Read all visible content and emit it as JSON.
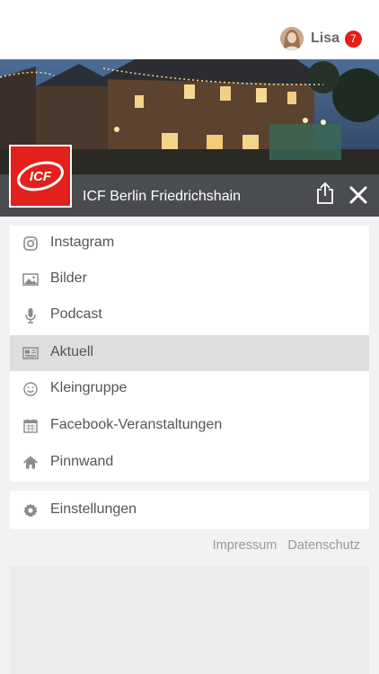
{
  "header": {
    "user_name": "Lisa",
    "notification_count": "7",
    "badge_color": "#e3201b"
  },
  "hero": {
    "church_name": "ICF Berlin Friedrichshain",
    "logo_text": "ICF",
    "share_icon": "share-icon",
    "close_icon": "close-icon"
  },
  "menu": {
    "items": [
      {
        "label": "Instagram",
        "icon": "instagram-icon",
        "active": false
      },
      {
        "label": "Bilder",
        "icon": "image-icon",
        "active": false
      },
      {
        "label": "Podcast",
        "icon": "microphone-icon",
        "active": false
      },
      {
        "label": "Aktuell",
        "icon": "newspaper-icon",
        "active": true
      },
      {
        "label": "Kleingruppe",
        "icon": "smiley-icon",
        "active": false
      },
      {
        "label": "Facebook-Veranstaltungen",
        "icon": "calendar-icon",
        "active": false
      },
      {
        "label": "Pinnwand",
        "icon": "home-icon",
        "active": false
      }
    ]
  },
  "settings": {
    "label": "Einstellungen",
    "icon": "gear-icon"
  },
  "footer": {
    "impressum": "Impressum",
    "datenschutz": "Datenschutz"
  }
}
